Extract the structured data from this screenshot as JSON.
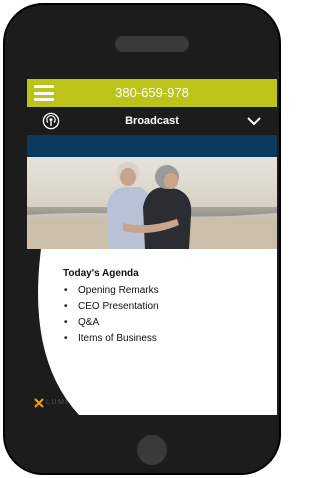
{
  "header": {
    "phone_number": "380-659-978"
  },
  "nav": {
    "title": "Broadcast"
  },
  "agenda": {
    "title": "Today's Agenda",
    "items": [
      "Opening Remarks",
      "CEO Presentation",
      "Q&A",
      "Items of Business"
    ]
  },
  "branding": {
    "logo_text": "LUMI"
  },
  "colors": {
    "accent": "#bcc41a",
    "nav_background": "#1c1c1c",
    "band": "#0c3a5e",
    "logo_mark": "#f39c12"
  },
  "icons": {
    "menu": "hamburger-menu-icon",
    "broadcast": "broadcast-icon",
    "expand": "chevron-down-icon"
  }
}
